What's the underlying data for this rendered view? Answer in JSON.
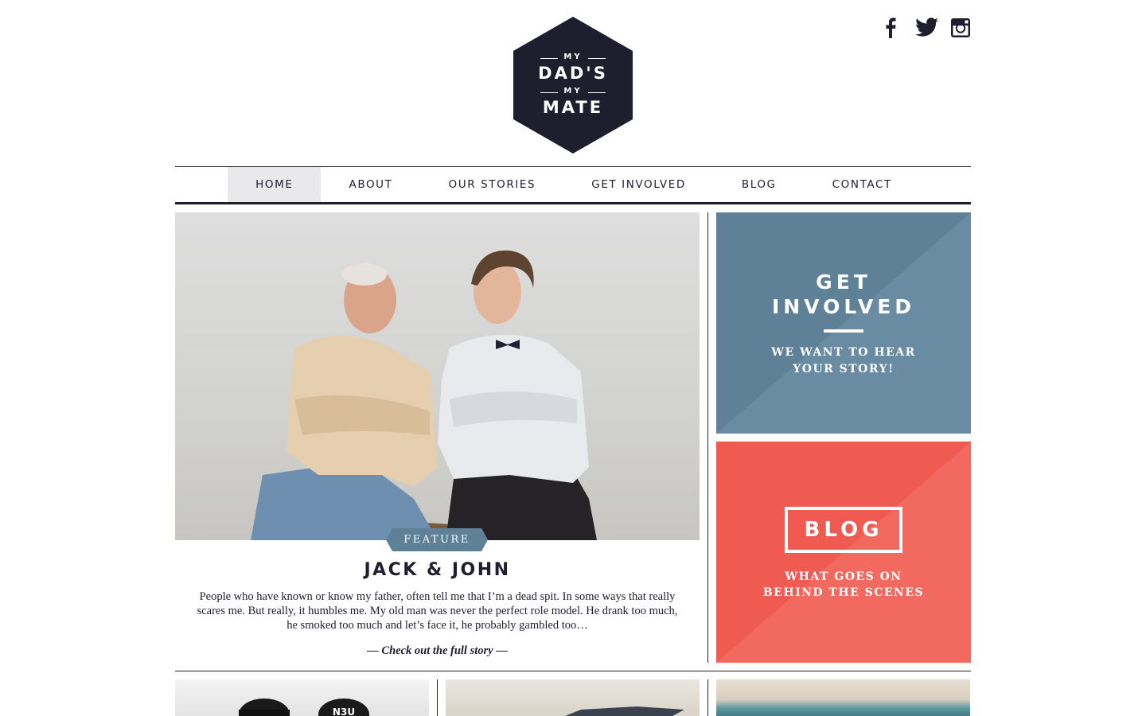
{
  "logo": {
    "line1": "MY",
    "line2": "DAD'S",
    "line3": "MY",
    "line4": "MATE",
    "color": "#1e1e2f"
  },
  "social": [
    {
      "name": "facebook-icon"
    },
    {
      "name": "twitter-icon"
    },
    {
      "name": "instagram-icon"
    }
  ],
  "nav": {
    "items": [
      {
        "label": "HOME",
        "active": true
      },
      {
        "label": "ABOUT"
      },
      {
        "label": "OUR STORIES"
      },
      {
        "label": "GET INVOLVED"
      },
      {
        "label": "BLOG"
      },
      {
        "label": "CONTACT"
      }
    ]
  },
  "feature": {
    "badge": "FEATURE",
    "title": "JACK & JOHN",
    "text": "People who have known or know my father, often tell me that I’m a dead spit. In some ways that really scares me. But really, it humbles me. My old man was never the perfect role model. He drank too much, he smoked too much and let’s face it, he probably gambled too…",
    "link": "— Check out the full story —",
    "badge_color": "#5f8197"
  },
  "tiles": {
    "get_involved": {
      "title_line1": "GET",
      "title_line2": "INVOLVED",
      "sub_line1": "WE WANT TO HEAR",
      "sub_line2": "YOUR STORY!",
      "color": "#5f8197"
    },
    "blog": {
      "title": "BLOG",
      "sub_line1": "WHAT GOES ON",
      "sub_line2": "BEHIND THE SCENES",
      "color": "#ef5b51"
    }
  }
}
